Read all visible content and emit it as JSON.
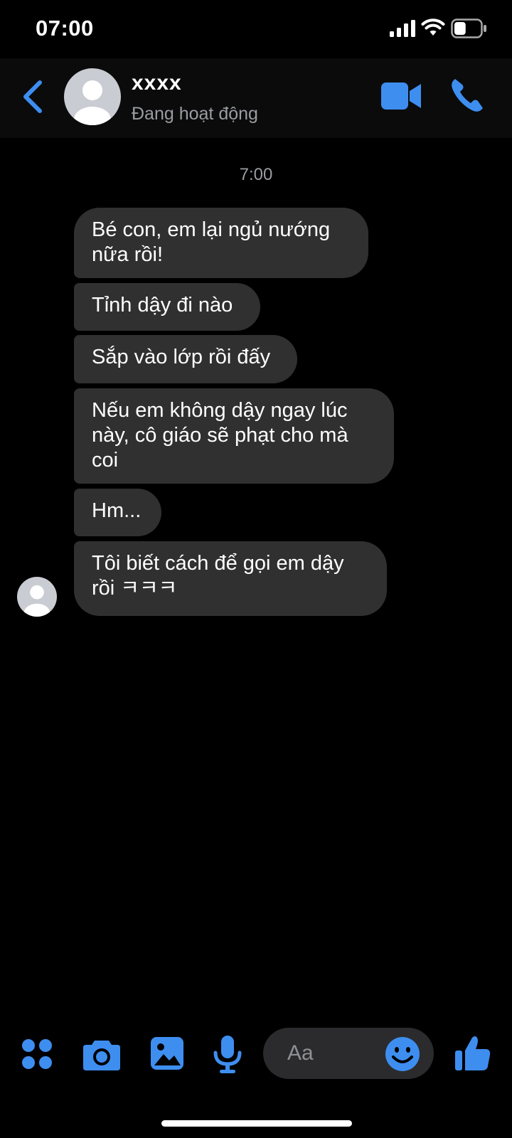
{
  "status_bar": {
    "time": "07:00",
    "battery_level": 0.45
  },
  "header": {
    "contact_name": "xxxx",
    "contact_status": "Đang hoạt động"
  },
  "messages": {
    "timestamp": "7:00",
    "items": [
      {
        "text": "Bé con, em lại ngủ nướng nữa rồi!"
      },
      {
        "text": "Tỉnh dậy đi nào"
      },
      {
        "text": "Sắp vào lớp rồi đấy"
      },
      {
        "text": "Nếu em không dậy ngay lúc này, cô giáo sẽ phạt cho mà coi"
      },
      {
        "text": "Hm..."
      },
      {
        "text": "Tôi biết cách để gọi em dậy rồi ㅋㅋㅋ"
      }
    ]
  },
  "composer": {
    "placeholder": "Aa"
  },
  "colors": {
    "accent": "#3e8ef0",
    "bubble": "#303030",
    "background": "#000000"
  }
}
